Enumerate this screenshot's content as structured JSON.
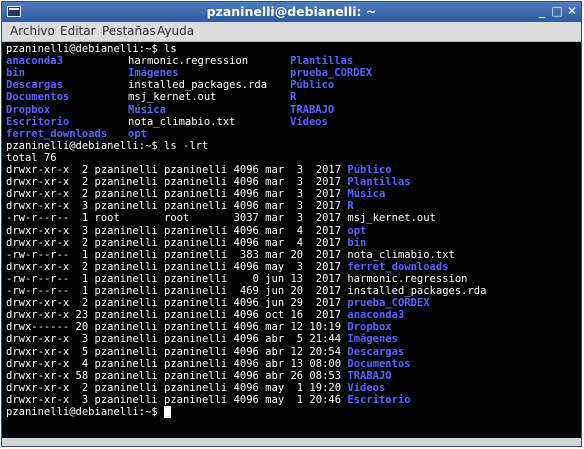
{
  "window": {
    "title": "pzaninelli@debianelli: ~",
    "controls": [
      "_",
      "□",
      "✕"
    ]
  },
  "menu": [
    "Archivo",
    "Editar",
    "Pestañas",
    "Ayuda"
  ],
  "terminal": {
    "prompt1": "pzaninelli@debianelli:~$ ls",
    "ls_rows": [
      [
        "anaconda3",
        "harmonic.regression",
        "Plantillas"
      ],
      [
        "bin",
        "Imágenes",
        "prueba_CORDEX"
      ],
      [
        "Descargas",
        "installed_packages.rda",
        "Público"
      ],
      [
        "Documentos",
        "msj_kernet.out",
        "R"
      ],
      [
        "Dropbox",
        "Música",
        "TRABAJO"
      ],
      [
        "Escritorio",
        "nota_climabio.txt",
        "Vídeos"
      ],
      [
        "ferret_downloads",
        "opt",
        ""
      ]
    ],
    "prompt2": "pzaninelli@debianelli:~$ ls -lrt",
    "total": "total 76",
    "ll_rows": [
      {
        "meta": "drwxr-xr-x  2 pzaninelli pzaninelli 4096 mar  3  2017",
        "name": "Público",
        "dir": true
      },
      {
        "meta": "drwxr-xr-x  2 pzaninelli pzaninelli 4096 mar  3  2017",
        "name": "Plantillas",
        "dir": true
      },
      {
        "meta": "drwxr-xr-x  2 pzaninelli pzaninelli 4096 mar  3  2017",
        "name": "Música",
        "dir": true
      },
      {
        "meta": "drwxr-xr-x  3 pzaninelli pzaninelli 4096 mar  3  2017",
        "name": "R",
        "dir": true
      },
      {
        "meta": "-rw-r--r--  1 root       root       3037 mar  3  2017",
        "name": "msj_kernet.out",
        "dir": false
      },
      {
        "meta": "drwxr-xr-x  3 pzaninelli pzaninelli 4096 mar  4  2017",
        "name": "opt",
        "dir": true
      },
      {
        "meta": "drwxr-xr-x  2 pzaninelli pzaninelli 4096 mar  4  2017",
        "name": "bin",
        "dir": true
      },
      {
        "meta": "-rw-r--r--  1 pzaninelli pzaninelli  383 mar 20  2017",
        "name": "nota_climabio.txt",
        "dir": false
      },
      {
        "meta": "drwxr-xr-x  2 pzaninelli pzaninelli 4096 may  3  2017",
        "name": "ferret_downloads",
        "dir": true
      },
      {
        "meta": "-rw-r--r--  1 pzaninelli pzaninelli    0 jun 13  2017",
        "name": "harmonic.regression",
        "dir": false
      },
      {
        "meta": "-rw-r--r--  1 pzaninelli pzaninelli  469 jun 20  2017",
        "name": "installed_packages.rda",
        "dir": false
      },
      {
        "meta": "drwxr-xr-x  2 pzaninelli pzaninelli 4096 jun 29  2017",
        "name": "prueba_CORDEX",
        "dir": true
      },
      {
        "meta": "drwxr-xr-x 23 pzaninelli pzaninelli 4096 oct 16  2017",
        "name": "anaconda3",
        "dir": true
      },
      {
        "meta": "drwx------ 20 pzaninelli pzaninelli 4096 mar 12 10:19",
        "name": "Dropbox",
        "dir": true
      },
      {
        "meta": "drwxr-xr-x  3 pzaninelli pzaninelli 4096 abr  5 21:44",
        "name": "Imágenes",
        "dir": true
      },
      {
        "meta": "drwxr-xr-x  5 pzaninelli pzaninelli 4096 abr 12 20:54",
        "name": "Descargas",
        "dir": true
      },
      {
        "meta": "drwxr-xr-x  4 pzaninelli pzaninelli 4096 abr 13 08:00",
        "name": "Documentos",
        "dir": true
      },
      {
        "meta": "drwxr-xr-x 58 pzaninelli pzaninelli 4096 abr 26 08:53",
        "name": "TRABAJO",
        "dir": true
      },
      {
        "meta": "drwxr-xr-x  2 pzaninelli pzaninelli 4096 may  1 19:20",
        "name": "Vídeos",
        "dir": true
      },
      {
        "meta": "drwxr-xr-x  3 pzaninelli pzaninelli 4096 may  1 20:46",
        "name": "Escritorio",
        "dir": true
      }
    ],
    "prompt3": "pzaninelli@debianelli:~$ "
  }
}
